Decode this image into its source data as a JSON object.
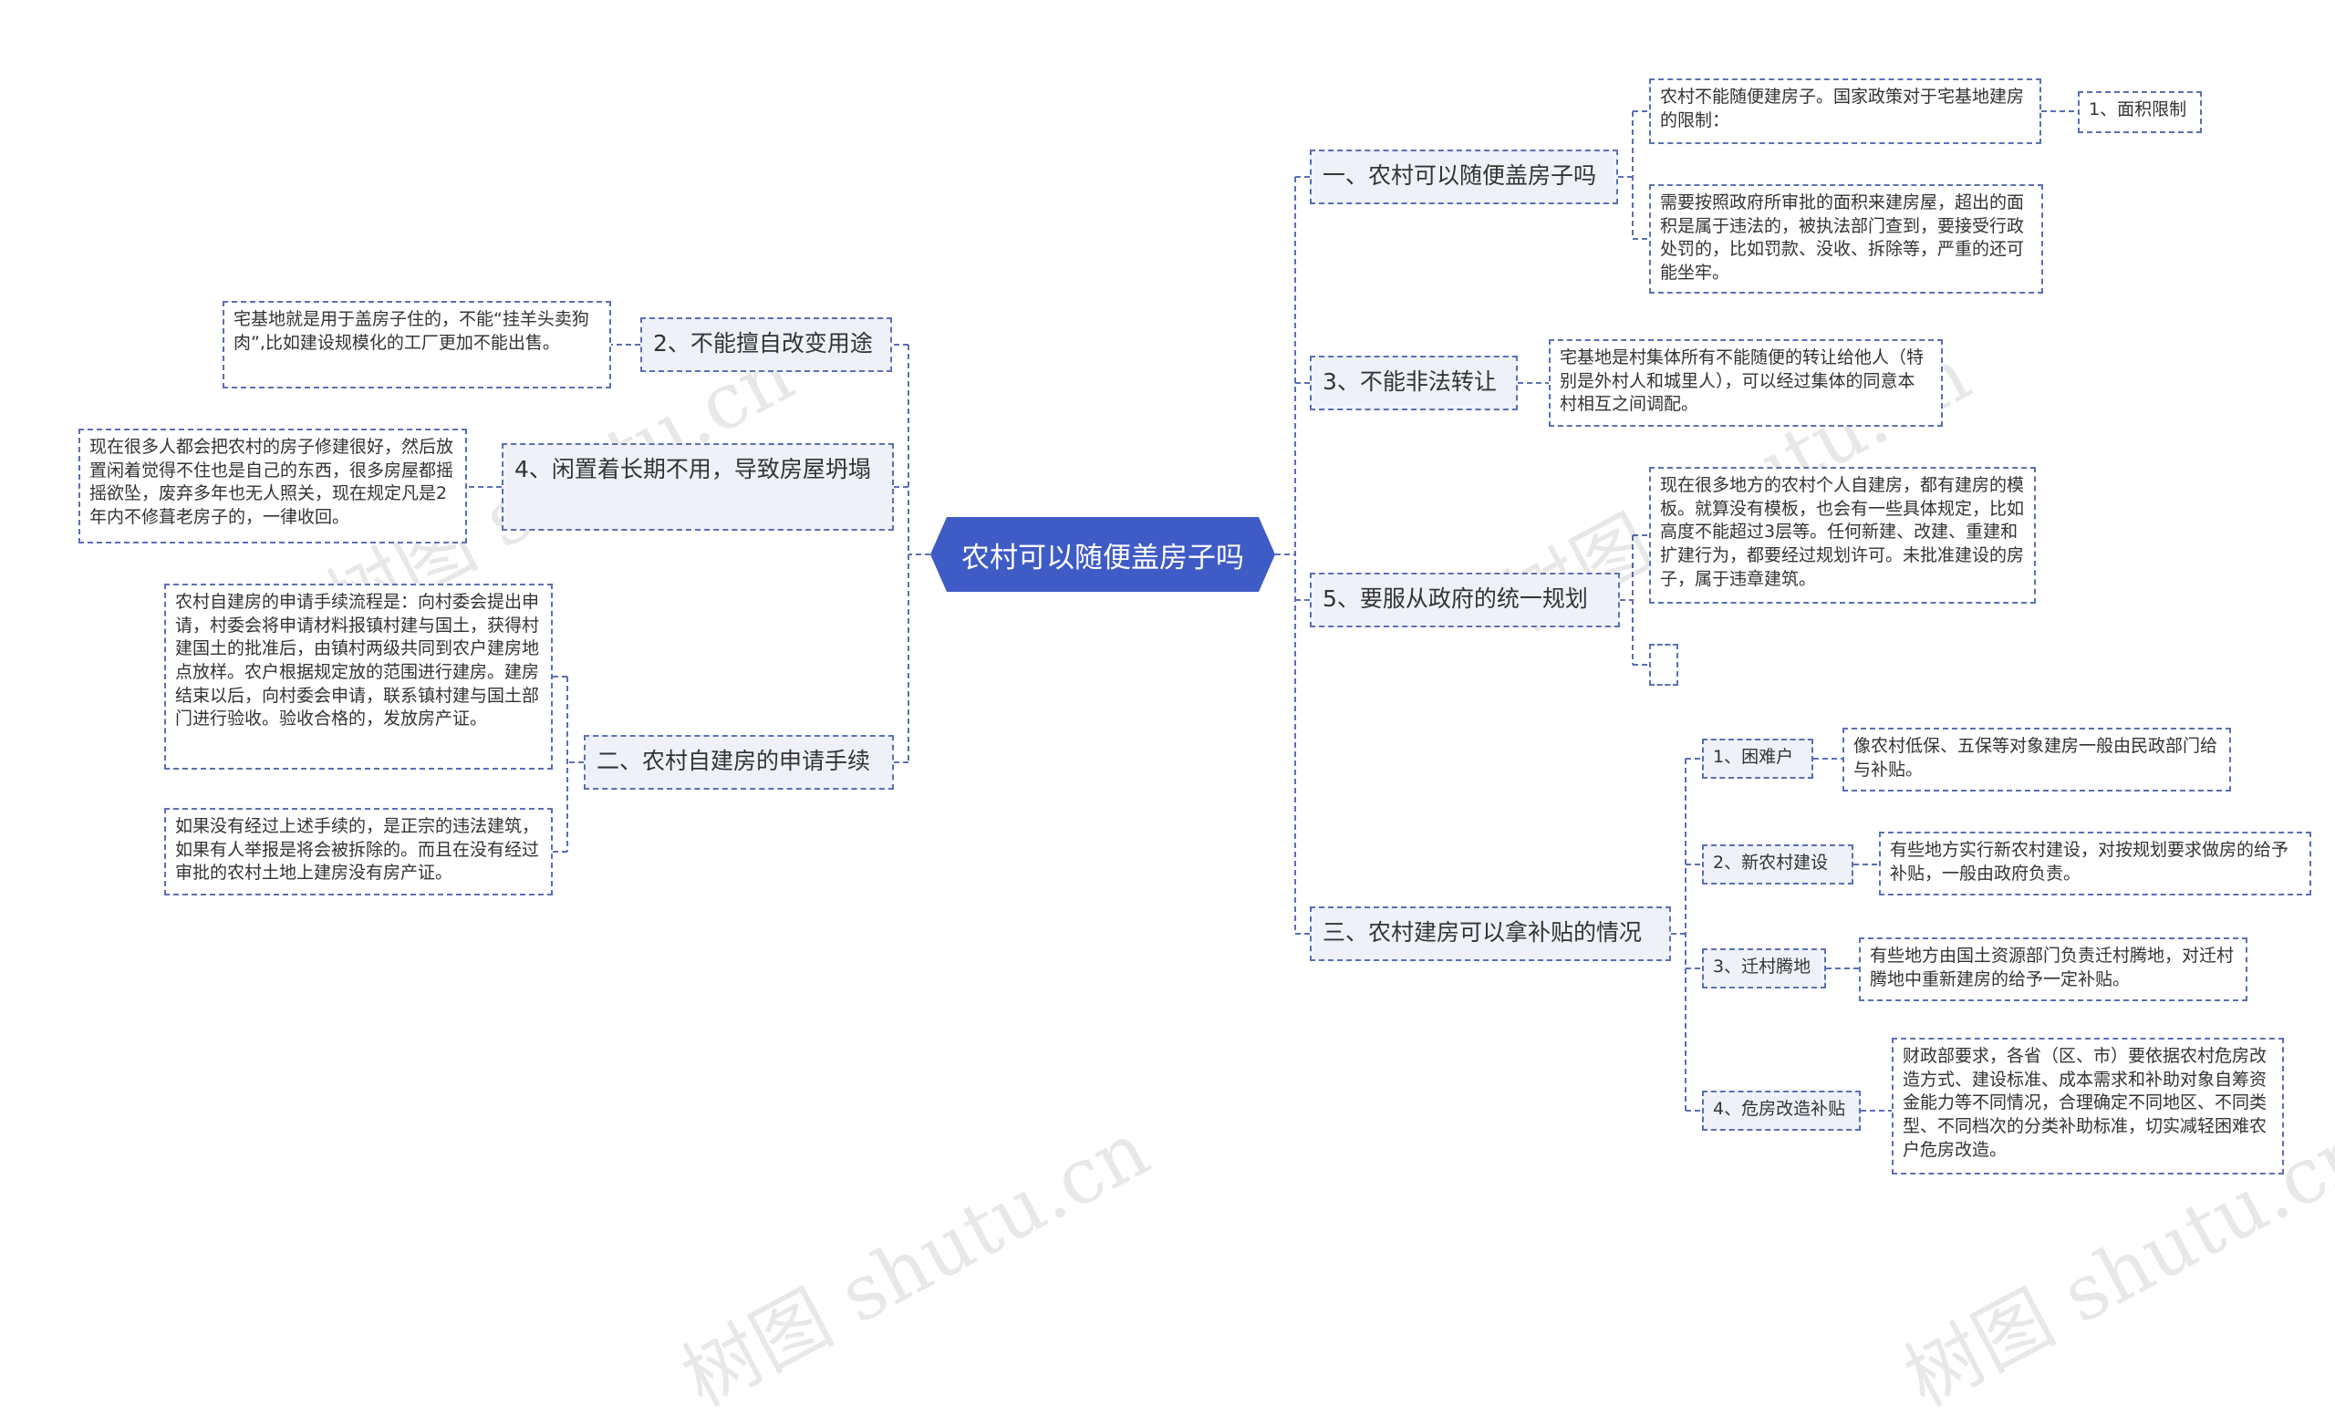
{
  "root": {
    "label": "农村可以随便盖房子吗"
  },
  "right": {
    "b1": {
      "label": "一、农村可以随便盖房子吗",
      "leaf1": "农村不能随便建房子。国家政策对于宅基地建房的限制：",
      "leaf1_child": "1、面积限制",
      "leaf2": "需要按照政府所审批的面积来建房屋，超出的面积是属于违法的，被执法部门查到，要接受行政处罚的，比如罚款、没收、拆除等，严重的还可能坐牢。"
    },
    "b3": {
      "label": "3、不能非法转让",
      "leaf": "宅基地是村集体所有不能随便的转让给他人（特别是外村人和城里人），可以经过集体的同意本村相互之间调配。"
    },
    "b5": {
      "label": "5、要服从政府的统一规划",
      "leaf": "现在很多地方的农村个人自建房，都有建房的模板。就算没有模板，也会有一些具体规定，比如高度不能超过3层等。任何新建、改建、重建和扩建行为，都要经过规划许可。未批准建设的房子，属于违章建筑。",
      "empty": ""
    },
    "b_subsidy": {
      "label": "三、农村建房可以拿补贴的情况",
      "items": [
        {
          "label": "1、困难户",
          "detail": "像农村低保、五保等对象建房一般由民政部门给与补贴。"
        },
        {
          "label": "2、新农村建设",
          "detail": "有些地方实行新农村建设，对按规划要求做房的给予补贴，一般由政府负责。"
        },
        {
          "label": "3、迁村腾地",
          "detail": "有些地方由国土资源部门负责迁村腾地，对迁村腾地中重新建房的给予一定补贴。"
        },
        {
          "label": "4、危房改造补贴",
          "detail": "财政部要求，各省（区、市）要依据农村危房改造方式、建设标准、成本需求和补助对象自筹资金能力等不同情况，合理确定不同地区、不同类型、不同档次的分类补助标准，切实减轻困难农户危房改造。"
        }
      ]
    }
  },
  "left": {
    "b2": {
      "label": "2、不能擅自改变用途",
      "leaf": "宅基地就是用于盖房子住的，不能“挂羊头卖狗肉”,比如建设规模化的工厂更加不能出售。"
    },
    "b4": {
      "label": "4、闲置着长期不用，导致房屋坍塌",
      "leaf": "现在很多人都会把农村的房子修建很好，然后放置闲着觉得不住也是自己的东西，很多房屋都摇摇欲坠，废弃多年也无人照关，现在规定凡是2年内不修葺老房子的，一律收回。"
    },
    "b_apply": {
      "label": "二、农村自建房的申请手续",
      "leaf1": "农村自建房的申请手续流程是：向村委会提出申请，村委会将申请材料报镇村建与国土，获得村建国土的批准后，由镇村两级共同到农户建房地点放样。农户根据规定放的范围进行建房。建房结束以后，向村委会申请，联系镇村建与国土部门进行验收。验收合格的，发放房产证。",
      "leaf2": "如果没有经过上述手续的，是正宗的违法建筑，如果有人举报是将会被拆除的。而且在没有经过审批的农村土地上建房没有房产证。"
    }
  },
  "colors": {
    "root": "#3f5bc6",
    "line": "#5b6fb5",
    "branch_bg": "#eef1f8"
  },
  "watermark": "树图 shutu.cn"
}
